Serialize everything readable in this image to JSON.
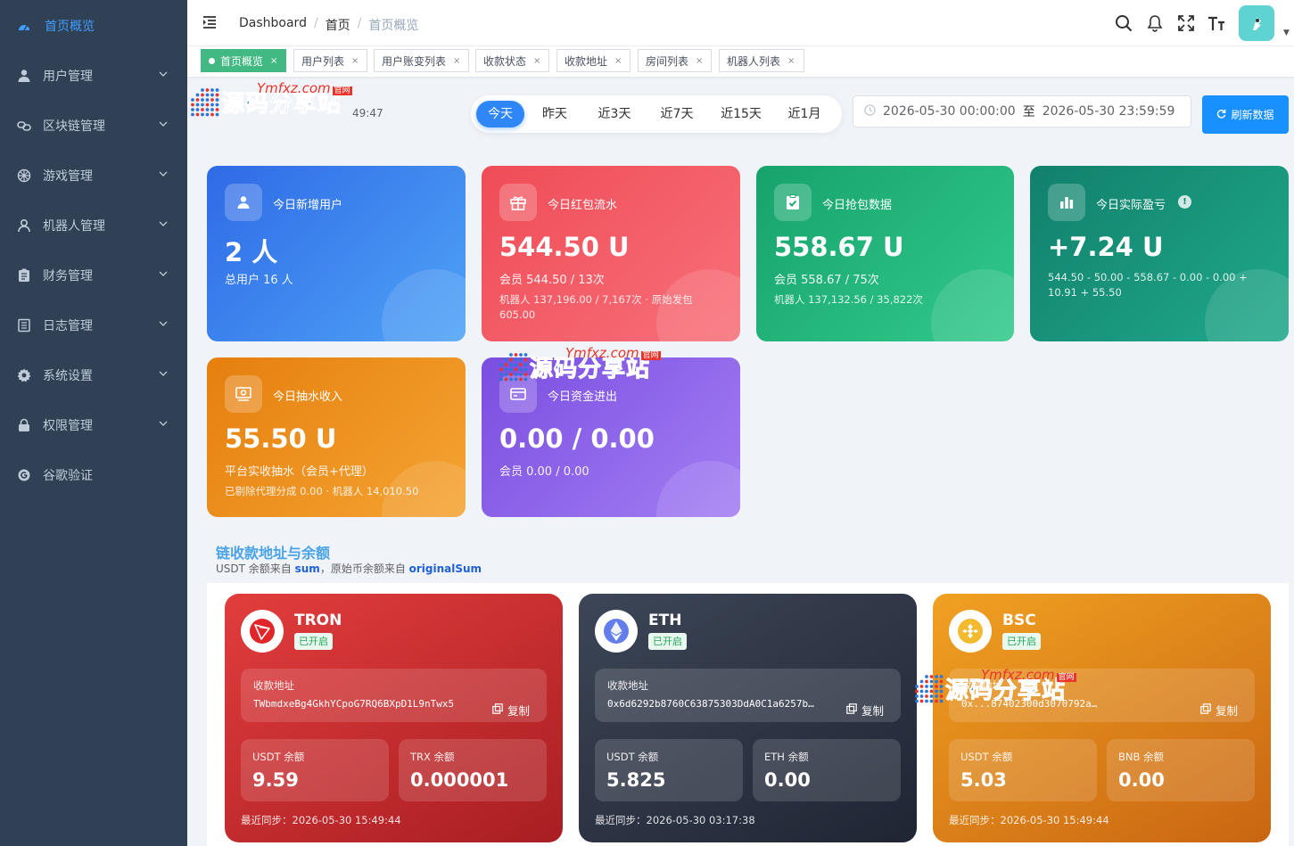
{
  "sidebar": {
    "items": [
      {
        "label": "首页概览",
        "icon": "dashboard-icon",
        "active": true,
        "chevron": false
      },
      {
        "label": "用户管理",
        "icon": "user-icon",
        "chevron": true
      },
      {
        "label": "区块链管理",
        "icon": "chain-icon",
        "chevron": true
      },
      {
        "label": "游戏管理",
        "icon": "game-icon",
        "chevron": true
      },
      {
        "label": "机器人管理",
        "icon": "robot-icon",
        "chevron": true
      },
      {
        "label": "财务管理",
        "icon": "finance-icon",
        "chevron": true
      },
      {
        "label": "日志管理",
        "icon": "log-icon",
        "chevron": true
      },
      {
        "label": "系统设置",
        "icon": "gear-icon",
        "chevron": true
      },
      {
        "label": "权限管理",
        "icon": "lock-icon",
        "chevron": true
      },
      {
        "label": "谷歌验证",
        "icon": "google-icon",
        "chevron": false
      }
    ]
  },
  "breadcrumb": {
    "items": [
      "Dashboard",
      "首页",
      "首页概览"
    ],
    "sep": "/"
  },
  "header_icons": [
    "search-icon",
    "bell-icon",
    "fullscreen-icon",
    "font-size-icon"
  ],
  "tags": [
    {
      "label": "首页概览",
      "active": true
    },
    {
      "label": "用户列表"
    },
    {
      "label": "用户账变列表"
    },
    {
      "label": "收款状态"
    },
    {
      "label": "收款地址"
    },
    {
      "label": "房间列表"
    },
    {
      "label": "机器人列表"
    }
  ],
  "tag_close": "×",
  "refresh_time_fragment": "49:47",
  "ranges": [
    "今天",
    "昨天",
    "近3天",
    "近7天",
    "近15天",
    "近1月"
  ],
  "daterange": {
    "start": "2026-05-30 00:00:00",
    "sep": "至",
    "end": "2026-05-30 23:59:59"
  },
  "refresh_button": "刷新数据",
  "stats": [
    {
      "title": "今日新增用户",
      "value": "2 人",
      "sub": "总用户 16 人",
      "detail": "",
      "icon": "user-icon",
      "colors": [
        "#2f6ae6",
        "#4fa3f7"
      ]
    },
    {
      "title": "今日红包流水",
      "value": "544.50 U",
      "sub": "会员 544.50 / 13次",
      "detail": "机器人 137,196.00 / 7,167次 · 原始发包 605.00",
      "icon": "gift-icon",
      "colors": [
        "#ef4c56",
        "#f8707a"
      ]
    },
    {
      "title": "今日抢包数据",
      "value": "558.67 U",
      "sub": "会员 558.67 / 75次",
      "detail": "机器人 137,132.56 / 35,822次",
      "icon": "clipboard-check-icon",
      "colors": [
        "#16a36b",
        "#32c98d"
      ]
    },
    {
      "title": "今日实际盈亏",
      "value": "+7.24 U",
      "sub": "",
      "detail": "544.50 - 50.00 - 558.67 - 0.00 - 0.00 + 10.91 + 55.50",
      "icon": "bar-chart-icon",
      "info": "!",
      "colors": [
        "#11806c",
        "#20a98a"
      ]
    },
    {
      "title": "今日抽水收入",
      "value": "55.50 U",
      "sub": "平台实收抽水（会员+代理）",
      "detail": "已剔除代理分成 0.00 · 机器人 14,010.50",
      "icon": "receipt-icon",
      "colors": [
        "#e57f0e",
        "#f5a433"
      ]
    },
    {
      "title": "今日资金进出",
      "value": "0.00 / 0.00",
      "sub": "会员 0.00 / 0.00",
      "detail": "",
      "icon": "wallet-icon",
      "colors": [
        "#7a4ee0",
        "#a37ef4"
      ]
    }
  ],
  "section": {
    "title": "链收款地址与余额",
    "desc_prefix": "USDT 余额来自 ",
    "desc_sum": "sum",
    "desc_mid": "，原始币余额来自 ",
    "desc_orig": "originalSum"
  },
  "chains": [
    {
      "name": "TRON",
      "status": "已开启",
      "addr_label": "收款地址",
      "address": "TWbmdxeBg4GkhYCpoG7RQ6BXpD1L9nTwx5",
      "copy": "复制",
      "usdt_label": "USDT 余额",
      "usdt": "9.59",
      "native_label": "TRX 余额",
      "native": "0.000001",
      "sync": "最近同步：2026-05-30 15:49:44",
      "icon": "tron-icon",
      "colors": [
        "#e23d3d",
        "#a81e22"
      ]
    },
    {
      "name": "ETH",
      "status": "已开启",
      "addr_label": "收款地址",
      "address": "0x6d6292b8760C63875303DdA0C1a6257b…",
      "copy": "复制",
      "usdt_label": "USDT 余额",
      "usdt": "5.825",
      "native_label": "ETH 余额",
      "native": "0.00",
      "sync": "最近同步：2026-05-30 03:17:38",
      "icon": "ethereum-icon",
      "colors": [
        "#3d4657",
        "#1f2533"
      ]
    },
    {
      "name": "BSC",
      "status": "已开启",
      "addr_label": "收款地址",
      "address": "0x...87402300d3070792a…",
      "copy": "复制",
      "usdt_label": "USDT 余额",
      "usdt": "5.03",
      "native_label": "BNB 余额",
      "native": "0.00",
      "sync": "最近同步：2026-05-30 15:49:44",
      "icon": "bnb-icon",
      "colors": [
        "#f0a122",
        "#c96512"
      ]
    }
  ],
  "watermark": {
    "top": "Ymfxz.com",
    "tag": "官网",
    "main": "源码分享站"
  }
}
